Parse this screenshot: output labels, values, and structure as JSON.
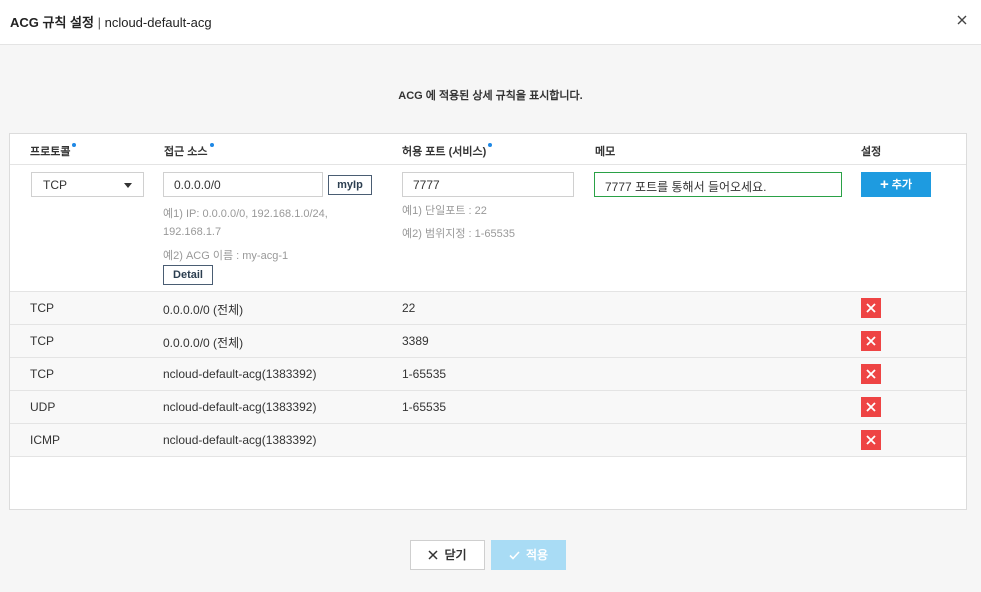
{
  "header": {
    "title_bold": "ACG 규칙 설정",
    "separator": "|",
    "title_sub": "ncloud-default-acg"
  },
  "description": "ACG 에 적용된 상세 규칙을 표시합니다.",
  "columns": {
    "protocol": "프로토콜",
    "source": "접근 소스",
    "port": "허용 포트 (서비스)",
    "memo": "메모",
    "settings": "설정"
  },
  "form": {
    "protocol_value": "TCP",
    "source_value": "0.0.0.0/0",
    "myip_label": "myIp",
    "source_hint1": "예1) IP: 0.0.0.0/0, 192.168.1.0/24,",
    "source_hint1b": "192.168.1.7",
    "source_hint2": "예2) ACG 이름 : my-acg-1",
    "detail_label": "Detail",
    "port_value": "7777",
    "port_hint1": "예1) 단일포트 : 22",
    "port_hint2": "예2) 범위지정 : 1-65535",
    "memo_value": "7777 포트를 통해서 들어오세요.",
    "add_label": "추가"
  },
  "rules": [
    {
      "protocol": "TCP",
      "source": "0.0.0.0/0 (전체)",
      "port": "22"
    },
    {
      "protocol": "TCP",
      "source": "0.0.0.0/0 (전체)",
      "port": "3389"
    },
    {
      "protocol": "TCP",
      "source": "ncloud-default-acg(1383392)",
      "port": "1-65535"
    },
    {
      "protocol": "UDP",
      "source": "ncloud-default-acg(1383392)",
      "port": "1-65535"
    },
    {
      "protocol": "ICMP",
      "source": "ncloud-default-acg(1383392)",
      "port": ""
    }
  ],
  "footer": {
    "close_label": "닫기",
    "apply_label": "적용"
  },
  "colors": {
    "accent": "#1e9be0",
    "delete": "#ee4444",
    "apply_disabled": "#a9dcf5",
    "memo_border": "#2aa146"
  }
}
